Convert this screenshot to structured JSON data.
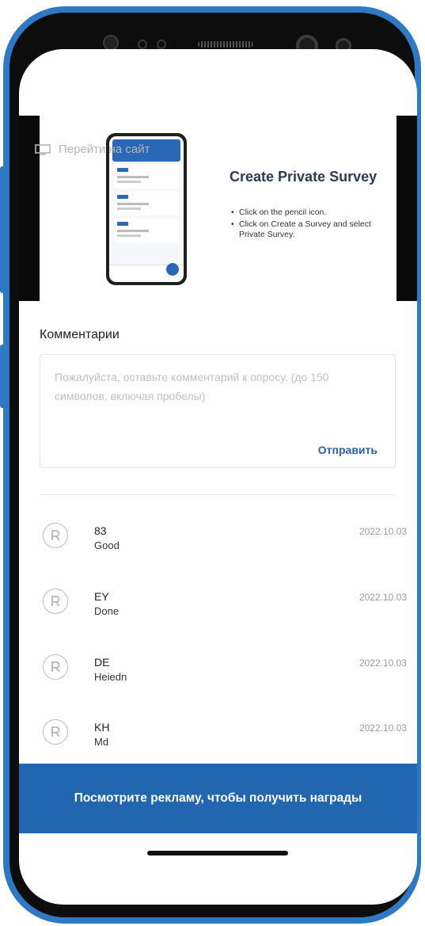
{
  "banner": {
    "visit_site": "Перейти на сайт",
    "title": "Create Private Survey",
    "bullets": [
      "Click on the pencil icon.",
      "Click on Create a Survey and select Private Survey."
    ]
  },
  "comments": {
    "title": "Комментарии",
    "placeholder": "Пожалуйста, оставьте комментарий к опросу. (до 150 символов, включая пробелы)",
    "send_label": "Отправить",
    "items": [
      {
        "name": "83",
        "text": "Good",
        "date": "2022.10.03"
      },
      {
        "name": "EY",
        "text": "Done",
        "date": "2022.10.03"
      },
      {
        "name": "DE",
        "text": "Heiedn",
        "date": "2022.10.03"
      },
      {
        "name": "KH",
        "text": "Md",
        "date": "2022.10.03"
      }
    ]
  },
  "ad": {
    "label": "Посмотрите рекламу, чтобы получить награды"
  },
  "colors": {
    "accent": "#2166af",
    "phone_frame": "#2f78c4"
  }
}
